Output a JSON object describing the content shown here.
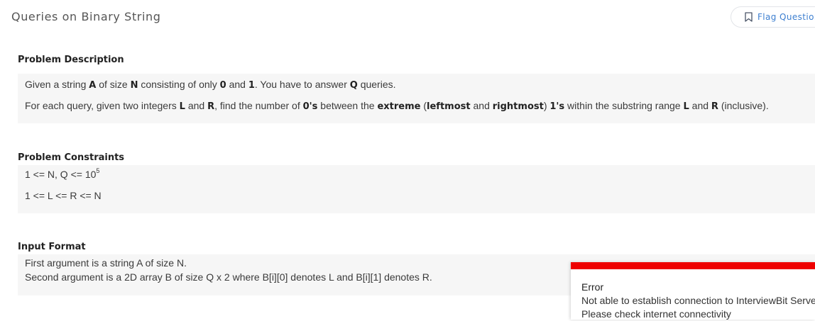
{
  "header": {
    "title": "Queries on Binary String",
    "flag_label": "Flag Question"
  },
  "description": {
    "heading": "Problem Description",
    "p1": {
      "t1": "Given a string ",
      "A": "A",
      "t2": " of size ",
      "N": "N",
      "t3": " consisting of only ",
      "zero": "0",
      "t4": " and ",
      "one": "1",
      "t5": ". You have to answer ",
      "Q": "Q",
      "t6": " queries."
    },
    "p2": {
      "t1": "For each query, given two integers ",
      "L": "L",
      "t2": " and ",
      "R": "R",
      "t3": ", find the number of ",
      "zeros": "0's",
      "t4": " between the ",
      "extreme": "extreme",
      "t5": " (",
      "leftmost": "leftmost",
      "t6": " and ",
      "rightmost": "rightmost",
      "t7": ") ",
      "ones": "1's",
      "t8": " within the substring range ",
      "L2": "L",
      "t9": " and ",
      "R2": "R",
      "t10": " (inclusive)."
    }
  },
  "constraints": {
    "heading": "Problem Constraints",
    "c1_base": "1 <= N, Q <= 10",
    "c1_exp": "5",
    "c2": "1 <= L <= R <= N"
  },
  "input_format": {
    "heading": "Input Format",
    "l1": "First argument is a string A of size N.",
    "l2": "Second argument is a 2D array B of size Q x 2 where B[i][0] denotes L and B[i][1] denotes R."
  },
  "toast": {
    "title": "Error",
    "line1": "Not able to establish connection to InterviewBit Server.",
    "line2": "Please check internet connectivity",
    "accent_color": "#ee0000"
  },
  "icons": {
    "flag": "bookmark-flag-icon"
  }
}
